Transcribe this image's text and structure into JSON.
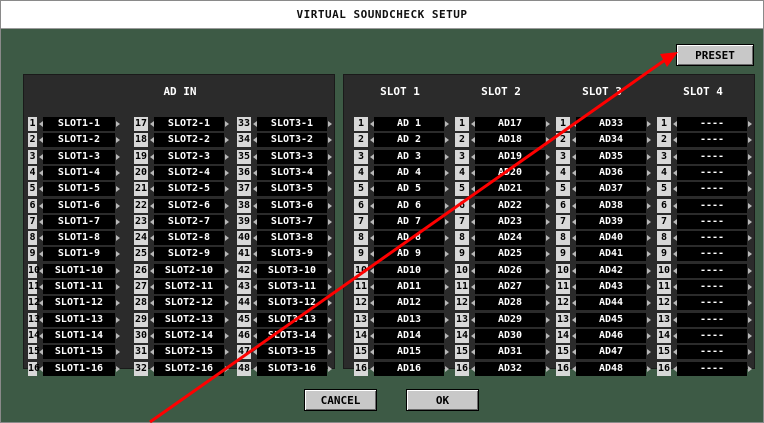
{
  "window": {
    "title": "VIRTUAL SOUNDCHECK SETUP"
  },
  "buttons": {
    "preset": "PRESET",
    "cancel": "CANCEL",
    "ok": "OK"
  },
  "adin": {
    "header": "AD IN",
    "columns": [
      {
        "numbers": [
          "1",
          "2",
          "3",
          "4",
          "5",
          "6",
          "7",
          "8",
          "9",
          "10",
          "11",
          "12",
          "13",
          "14",
          "15",
          "16"
        ],
        "labels": [
          "SLOT1-1",
          "SLOT1-2",
          "SLOT1-3",
          "SLOT1-4",
          "SLOT1-5",
          "SLOT1-6",
          "SLOT1-7",
          "SLOT1-8",
          "SLOT1-9",
          "SLOT1-10",
          "SLOT1-11",
          "SLOT1-12",
          "SLOT1-13",
          "SLOT1-14",
          "SLOT1-15",
          "SLOT1-16"
        ]
      },
      {
        "numbers": [
          "17",
          "18",
          "19",
          "20",
          "21",
          "22",
          "23",
          "24",
          "25",
          "26",
          "27",
          "28",
          "29",
          "30",
          "31",
          "32"
        ],
        "labels": [
          "SLOT2-1",
          "SLOT2-2",
          "SLOT2-3",
          "SLOT2-4",
          "SLOT2-5",
          "SLOT2-6",
          "SLOT2-7",
          "SLOT2-8",
          "SLOT2-9",
          "SLOT2-10",
          "SLOT2-11",
          "SLOT2-12",
          "SLOT2-13",
          "SLOT2-14",
          "SLOT2-15",
          "SLOT2-16"
        ]
      },
      {
        "numbers": [
          "33",
          "34",
          "35",
          "36",
          "37",
          "38",
          "39",
          "40",
          "41",
          "42",
          "43",
          "44",
          "45",
          "46",
          "47",
          "48"
        ],
        "labels": [
          "SLOT3-1",
          "SLOT3-2",
          "SLOT3-3",
          "SLOT3-4",
          "SLOT3-5",
          "SLOT3-6",
          "SLOT3-7",
          "SLOT3-8",
          "SLOT3-9",
          "SLOT3-10",
          "SLOT3-11",
          "SLOT3-12",
          "SLOT3-13",
          "SLOT3-14",
          "SLOT3-15",
          "SLOT3-16"
        ]
      }
    ]
  },
  "slots": {
    "columns": [
      {
        "header": "SLOT 1",
        "numbers": [
          "1",
          "2",
          "3",
          "4",
          "5",
          "6",
          "7",
          "8",
          "9",
          "10",
          "11",
          "12",
          "13",
          "14",
          "15",
          "16"
        ],
        "labels": [
          "AD 1",
          "AD 2",
          "AD 3",
          "AD 4",
          "AD 5",
          "AD 6",
          "AD 7",
          "AD 8",
          "AD 9",
          "AD10",
          "AD11",
          "AD12",
          "AD13",
          "AD14",
          "AD15",
          "AD16"
        ]
      },
      {
        "header": "SLOT 2",
        "numbers": [
          "1",
          "2",
          "3",
          "4",
          "5",
          "6",
          "7",
          "8",
          "9",
          "10",
          "11",
          "12",
          "13",
          "14",
          "15",
          "16"
        ],
        "labels": [
          "AD17",
          "AD18",
          "AD19",
          "AD20",
          "AD21",
          "AD22",
          "AD23",
          "AD24",
          "AD25",
          "AD26",
          "AD27",
          "AD28",
          "AD29",
          "AD30",
          "AD31",
          "AD32"
        ]
      },
      {
        "header": "SLOT 3",
        "numbers": [
          "1",
          "2",
          "3",
          "4",
          "5",
          "6",
          "7",
          "8",
          "9",
          "10",
          "11",
          "12",
          "13",
          "14",
          "15",
          "16"
        ],
        "labels": [
          "AD33",
          "AD34",
          "AD35",
          "AD36",
          "AD37",
          "AD38",
          "AD39",
          "AD40",
          "AD41",
          "AD42",
          "AD43",
          "AD44",
          "AD45",
          "AD46",
          "AD47",
          "AD48"
        ]
      },
      {
        "header": "SLOT 4",
        "numbers": [
          "1",
          "2",
          "3",
          "4",
          "5",
          "6",
          "7",
          "8",
          "9",
          "10",
          "11",
          "12",
          "13",
          "14",
          "15",
          "16"
        ],
        "labels": [
          "----",
          "----",
          "----",
          "----",
          "----",
          "----",
          "----",
          "----",
          "----",
          "----",
          "----",
          "----",
          "----",
          "----",
          "----",
          "----"
        ]
      }
    ]
  },
  "annotation": {
    "color": "#ff0000"
  }
}
